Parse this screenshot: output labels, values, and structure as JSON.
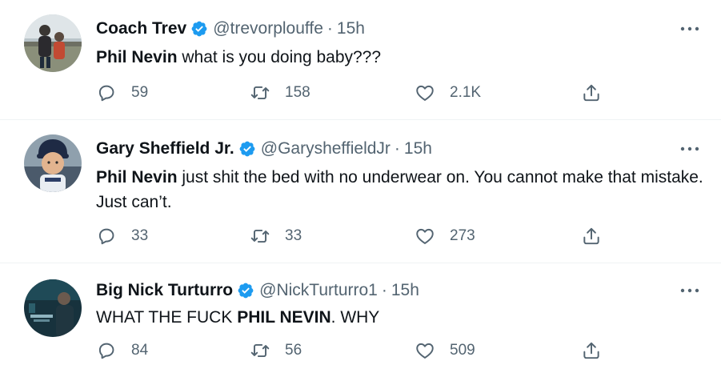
{
  "tweets": [
    {
      "name": "Coach Trev",
      "handle": "@trevorplouffe",
      "time": "15h",
      "text_bold": "Phil Nevin",
      "text_rest": " what is you doing baby???",
      "replies": "59",
      "retweets": "158",
      "likes": "2.1K"
    },
    {
      "name": "Gary Sheffield Jr.",
      "handle": "@GarysheffieldJr",
      "time": "15h",
      "text_bold": "Phil Nevin",
      "text_rest": " just shit the bed with no underwear on. You cannot make that mistake. Just can’t.",
      "replies": "33",
      "retweets": "33",
      "likes": "273"
    },
    {
      "name": "Big Nick Turturro",
      "handle": "@NickTurturro1",
      "time": "15h",
      "text_pre": "WHAT THE FUCK ",
      "text_bold": "PHIL NEVIN",
      "text_post": ". WHY",
      "replies": "84",
      "retweets": "56",
      "likes": "509"
    }
  ],
  "separator": "·",
  "icons": {
    "verified": "verified-badge-icon",
    "more": "more-dots-icon",
    "reply": "reply-bubble-icon",
    "retweet": "retweet-icon",
    "like": "heart-icon",
    "share": "share-upload-icon"
  },
  "colors": {
    "verified": "#1d9bf0",
    "text": "#0f1419",
    "secondary": "#536471",
    "divider": "#eff3f4"
  }
}
